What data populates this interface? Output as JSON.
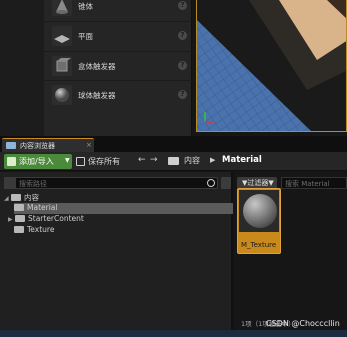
{
  "place_panel": {
    "items": [
      {
        "icon": "cube-icon",
        "label": "锥体"
      },
      {
        "icon": "plane-icon",
        "label": "平面"
      },
      {
        "icon": "box-trigger-icon",
        "label": "盒体触发器"
      },
      {
        "icon": "sphere-trigger-icon",
        "label": "球体触发器"
      }
    ],
    "help_glyph": "?"
  },
  "content_browser": {
    "tab_label": "内容浏览器",
    "tab_close": "×",
    "toolbar": {
      "add_import_label": "添加/导入",
      "add_import_caret": "▼",
      "save_all_label": "保存所有",
      "back_arrow": "←",
      "forward_arrow": "→",
      "breadcrumb": [
        "内容",
        "Material"
      ],
      "breadcrumb_sep": "▶"
    },
    "tree": {
      "search_placeholder": "搜索路径",
      "root": "内容",
      "children": [
        "Material",
        "StarterContent",
        "Texture"
      ]
    },
    "assets": {
      "filters_label": "▼过滤器▼",
      "search_placeholder": "搜索 Material",
      "items": [
        {
          "name": "M_Texture"
        }
      ],
      "count_text": "1项（1项被选中）"
    }
  },
  "watermark": "CSDN @Chocccllin",
  "colors": {
    "accent_orange": "#c9891b",
    "add_button_green": "#4b8a3a",
    "viewport_border": "#b78d2a",
    "status_bar_blue": "#1c2c40"
  }
}
